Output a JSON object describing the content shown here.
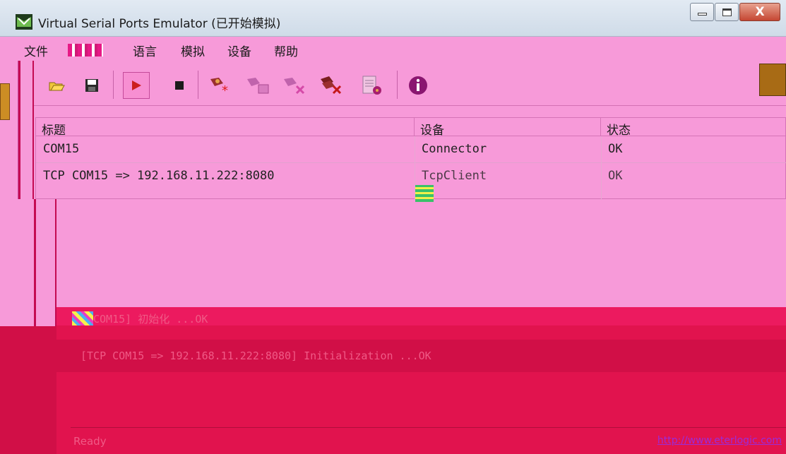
{
  "window": {
    "title": "Virtual Serial Ports Emulator (已开始模拟)",
    "close_label": "X"
  },
  "menu": {
    "file": "文件",
    "language": "语言",
    "emulation": "模拟",
    "device": "设备",
    "help": "帮助"
  },
  "toolbar": {
    "icons": [
      "open-icon",
      "save-icon",
      "play-icon",
      "stop-icon",
      "device-create-icon",
      "device-edit-icon",
      "device-delete-icon",
      "device-delete-all-icon",
      "settings-icon",
      "info-icon"
    ]
  },
  "table": {
    "headers": [
      "标题",
      "设备",
      "状态"
    ],
    "rows": [
      {
        "title": "COM15",
        "device": "Connector",
        "status": "OK"
      },
      {
        "title": "TCP COM15 => 192.168.11.222:8080",
        "device": "TcpClient",
        "status": "OK"
      }
    ]
  },
  "log": {
    "line1": "COM15] 初始化 ...OK",
    "line2": "[TCP COM15 => 192.168.11.222:8080] Initialization ...OK"
  },
  "status": {
    "ready": "Ready",
    "url": "http://www.eterlogic.com"
  },
  "colors": {
    "background": "#f79ad9",
    "log_background": "#e1134e",
    "accent": "#c40a52"
  }
}
